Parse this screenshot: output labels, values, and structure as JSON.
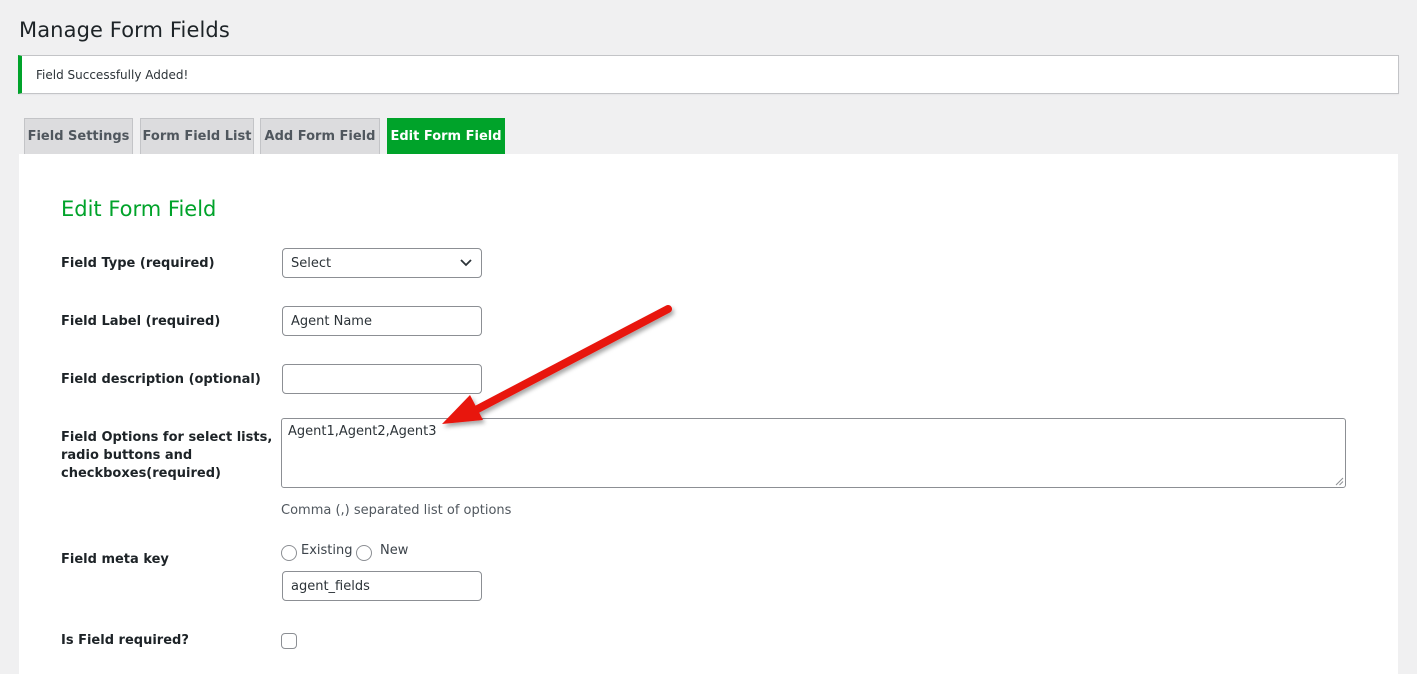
{
  "page": {
    "title": "Manage Form Fields"
  },
  "notice": {
    "message": "Field Successfully Added!"
  },
  "tabs": [
    {
      "label": "Field Settings",
      "active": false
    },
    {
      "label": "Form Field List",
      "active": false
    },
    {
      "label": "Add Form Field",
      "active": false
    },
    {
      "label": "Edit Form Field",
      "active": true
    }
  ],
  "form": {
    "title": "Edit Form Field",
    "field_type": {
      "label": "Field Type (required)",
      "selected": "Select"
    },
    "field_label": {
      "label": "Field Label (required)",
      "value": "Agent Name"
    },
    "field_description": {
      "label": "Field description (optional)",
      "value": ""
    },
    "field_options": {
      "label_line1": "Field Options for select lists,",
      "label_line2": "radio buttons and",
      "label_line3": "checkboxes(required)",
      "value": "Agent1,Agent2,Agent3",
      "hint": "Comma (,) separated list of options"
    },
    "meta_key": {
      "label": "Field meta key",
      "option_existing": "Existing",
      "option_new": "New",
      "value": "agent_fields"
    },
    "required": {
      "label": "Is Field required?",
      "checked": false
    }
  },
  "colors": {
    "accent_green": "#00a32a",
    "annotation_arrow": "#e8130f"
  }
}
